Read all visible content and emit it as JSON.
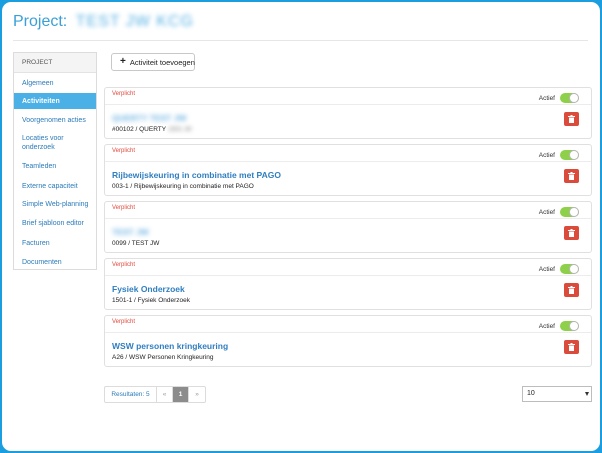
{
  "header": {
    "title_prefix": "Project:",
    "project_name": "TEST JW KCG"
  },
  "sidebar": {
    "heading": "PROJECT",
    "items": [
      {
        "label": "Algemeen"
      },
      {
        "label": "Activiteiten",
        "active": true
      },
      {
        "label": "Voorgenomen acties"
      },
      {
        "label": "Locaties voor onderzoek"
      },
      {
        "label": "Teamleden"
      },
      {
        "label": "Externe capaciteit"
      },
      {
        "label": "Simple Web-planning"
      },
      {
        "label": "Brief sjabloon editor"
      },
      {
        "label": "Facturen"
      },
      {
        "label": "Documenten"
      }
    ]
  },
  "toolbar": {
    "add_label": "Activiteit toevoegen"
  },
  "activities": [
    {
      "badge": "Verplicht",
      "status_label": "Actief",
      "name": "QUERTY TEST JW",
      "code": "#00102 / QUERTY",
      "code_extra": "1501 30",
      "blurred": true
    },
    {
      "badge": "Verplicht",
      "status_label": "Actief",
      "name": "Rijbewijskeuring in combinatie met PAGO",
      "code": "003-1 / Rijbewijskeuring in combinatie met PAGO",
      "code_extra": "",
      "blurred": false
    },
    {
      "badge": "Verplicht",
      "status_label": "Actief",
      "name": "TEST JW",
      "code": "0099 / TEST JW",
      "code_extra": "",
      "blurred": true
    },
    {
      "badge": "Verplicht",
      "status_label": "Actief",
      "name": "Fysiek Onderzoek",
      "code": "1501-1 / Fysiek Onderzoek",
      "code_extra": "",
      "blurred": false
    },
    {
      "badge": "Verplicht",
      "status_label": "Actief",
      "name": "WSW personen kringkeuring",
      "code": "A26 / WSW Personen Kringkeuring",
      "code_extra": "",
      "blurred": false
    }
  ],
  "pagination": {
    "results_label": "Resultaten: 5",
    "prev": "«",
    "current_page": "1",
    "next": "»"
  },
  "page_size": {
    "selected": "10"
  },
  "colors": {
    "accent": "#3aa0d8",
    "active_nav": "#4ab0e6",
    "danger": "#db4b3b",
    "toggle_on": "#8fd04a",
    "badge": "#e2493d"
  }
}
